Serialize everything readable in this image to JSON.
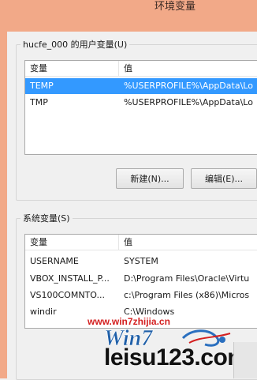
{
  "window": {
    "title": "环境变量"
  },
  "user_vars": {
    "group_label": "hucfe_000 的用户变量(U)",
    "columns": [
      "变量",
      "值"
    ],
    "rows": [
      {
        "name": "TEMP",
        "value": "%USERPROFILE%\\AppData\\Lo",
        "selected": true
      },
      {
        "name": "TMP",
        "value": "%USERPROFILE%\\AppData\\Lo",
        "selected": false
      }
    ],
    "buttons": {
      "new_label": "新建(N)...",
      "edit_label": "编辑(E)..."
    }
  },
  "system_vars": {
    "group_label": "系统变量(S)",
    "columns": [
      "变量",
      "值"
    ],
    "rows": [
      {
        "name": "USERNAME",
        "value": "SYSTEM"
      },
      {
        "name": "VBOX_INSTALL_P...",
        "value": "D:\\Program Files\\Oracle\\Virtu"
      },
      {
        "name": "VS100COMNTO...",
        "value": "c:\\Program Files (x86)\\Micros"
      },
      {
        "name": "windir",
        "value": "C:\\Windows"
      }
    ]
  },
  "watermark": {
    "site_text": "www.win7zhijia.cn",
    "logo_text": "Win7",
    "main_text": "leisu123.com",
    "colors": {
      "site": "#d42020",
      "logo": "#1f5fa8",
      "main": "#111111"
    }
  },
  "colors": {
    "titlebar": "#f2a988",
    "selection": "#3399ff",
    "dialog_bg": "#f0f0f0"
  }
}
